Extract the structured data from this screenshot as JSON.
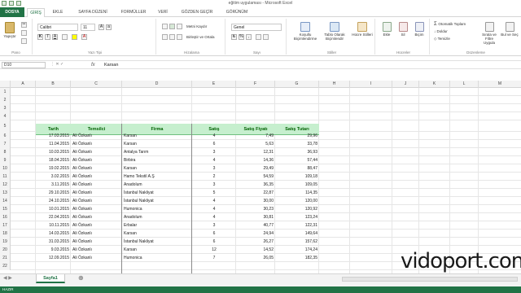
{
  "window": {
    "title": "eğitim uygulaması - Microsoft Excel"
  },
  "ribbon_tabs": [
    "DOSYA",
    "GİRİŞ",
    "EKLE",
    "SAYFA DÜZENİ",
    "FORMÜLLER",
    "VERİ",
    "GÖZDEN GEÇİR",
    "GÖRÜNÜM"
  ],
  "ribbon": {
    "paste": "Yapıştır",
    "font_name": "Calibri",
    "font_size": "11",
    "wrap": "Metni Kaydır",
    "merge": "Birleştir ve Ortala",
    "number_format": "Genel",
    "cond_format": "Koşullu Biçimlendirme",
    "table_format": "Tablo Olarak Biçimlendir",
    "cell_styles": "Hücre Stilleri",
    "insert": "Ekle",
    "delete": "Sil",
    "format": "Biçim",
    "autosum": "Otomatik Toplam",
    "fill": "Doldur",
    "clear": "Temizle",
    "sort": "Sırala ve Filtre Uygula",
    "find": "Bul ve Seç",
    "groups": [
      "Pano",
      "Yazı Tipi",
      "Hizalama",
      "Sayı",
      "Stiller",
      "Hücreler",
      "Düzenleme"
    ]
  },
  "formula_bar": {
    "name_box": "D10",
    "fx": "fx",
    "value": "Karsan"
  },
  "columns": [
    "A",
    "B",
    "C",
    "D",
    "E",
    "F",
    "G",
    "H",
    "I",
    "J",
    "K",
    "L",
    "M"
  ],
  "row_numbers": [
    "1",
    "2",
    "3",
    "4",
    "5",
    "6",
    "7",
    "8",
    "9",
    "10",
    "11",
    "12",
    "13",
    "14",
    "15",
    "16",
    "17",
    "18",
    "19",
    "20",
    "21",
    "22"
  ],
  "table": {
    "headers": [
      "Tarih",
      "Temsilci",
      "Firma",
      "Satış",
      "Satış Fiyatı",
      "Satış Tutarı"
    ],
    "rows": [
      [
        "17.03.2015",
        "Ali Özkanlı",
        "Karsan",
        "4",
        "7,49",
        "29,96"
      ],
      [
        "11.04.2015",
        "Ali Özkanlı",
        "Karsan",
        "6",
        "5,63",
        "33,78"
      ],
      [
        "10.03.2015",
        "Ali Özkanlı",
        "Antalya Tarım",
        "3",
        "12,31",
        "36,93"
      ],
      [
        "18.04.2015",
        "Ali Özkanlı",
        "Birbira",
        "4",
        "14,36",
        "57,44"
      ],
      [
        "19.02.2015",
        "Ali Özkanlı",
        "Karsan",
        "3",
        "29,49",
        "88,47"
      ],
      [
        "3.02.2015",
        "Ali Özkanlı",
        "Hamo Tekstil A.Ş",
        "2",
        "54,59",
        "109,18"
      ],
      [
        "3.11.2015",
        "Ali Özkanlı",
        "Anadolum",
        "3",
        "36,35",
        "109,05"
      ],
      [
        "29.10.2015",
        "Ali Özkanlı",
        "İstanbul Nakliyat",
        "5",
        "22,87",
        "114,35"
      ],
      [
        "24.10.2015",
        "Ali Özkanlı",
        "İstanbul Nakliyat",
        "4",
        "30,00",
        "120,00"
      ],
      [
        "10.01.2015",
        "Ali Özkanlı",
        "Humonica",
        "4",
        "30,23",
        "120,92"
      ],
      [
        "22.04.2015",
        "Ali Özkanlı",
        "Anadolum",
        "4",
        "30,81",
        "123,24"
      ],
      [
        "10.11.2015",
        "Ali Özkanlı",
        "Erbalar",
        "3",
        "40,77",
        "122,31"
      ],
      [
        "14.03.2015",
        "Ali Özkanlı",
        "Karsan",
        "6",
        "24,94",
        "149,64"
      ],
      [
        "31.03.2015",
        "Ali Özkanlı",
        "İstanbul Nakliyat",
        "6",
        "26,27",
        "157,62"
      ],
      [
        "9.03.2015",
        "Ali Özkanlı",
        "Karsan",
        "12",
        "14,52",
        "174,24"
      ],
      [
        "12.09.2015",
        "Ali Özkanlı",
        "Humonica",
        "7",
        "26,05",
        "182,35"
      ]
    ]
  },
  "sheet": {
    "tab": "Sayfa1",
    "add": "⊕"
  },
  "status": {
    "mode": "HAZIR"
  },
  "watermark": "vidoport.com",
  "colors": {
    "excel_green": "#217346",
    "header_fill": "#c6efce",
    "header_text": "#006100"
  }
}
